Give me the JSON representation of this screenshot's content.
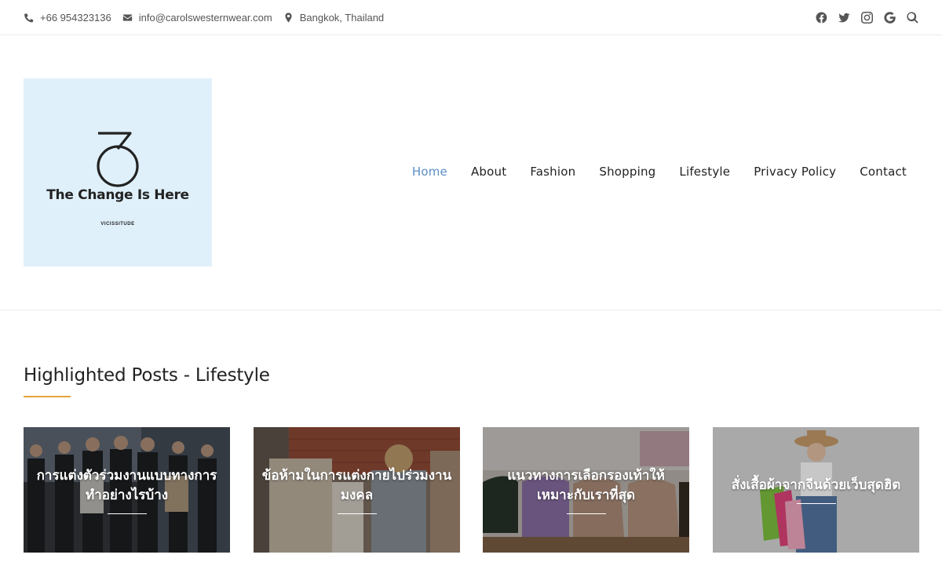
{
  "topbar": {
    "phone": "+66 954323136",
    "email": "info@carolswesternwear.com",
    "location": "Bangkok, Thailand",
    "social_icons": [
      "facebook-icon",
      "twitter-icon",
      "instagram-icon",
      "google-icon",
      "search-icon"
    ]
  },
  "logo": {
    "title": "The Change Is Here",
    "subtitle": "VICISSITUDE",
    "background": "#e0f0fa"
  },
  "nav": {
    "items": [
      "Home",
      "About",
      "Fashion",
      "Shopping",
      "Lifestyle",
      "Privacy Policy",
      "Contact"
    ],
    "active": "Home",
    "active_color": "#5b8fc4"
  },
  "highlighted": {
    "title": "Highlighted Posts - Lifestyle",
    "accent_color": "#e6a23c",
    "posts": [
      {
        "title": "การแต่งตัวร่วมงานแบบทางการทำอย่างไรบ้าง"
      },
      {
        "title": "ข้อห้ามในการแต่งกายไปร่วมงานมงคล"
      },
      {
        "title": "แนวทางการเลือกรองเท้าให้เหมาะกับเราที่สุด"
      },
      {
        "title": "สั่งเสื้อผ้าจากจีนด้วยเว็บสุดฮิต"
      }
    ]
  }
}
